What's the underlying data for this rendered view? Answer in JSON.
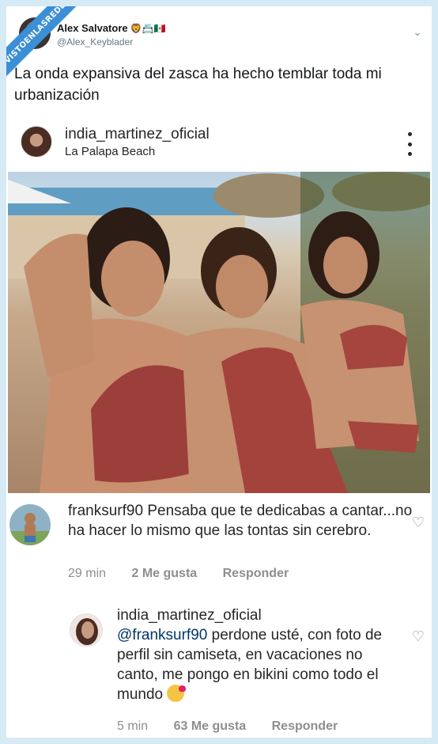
{
  "watermark": "VISTOENLASREDES",
  "tweet": {
    "name": "Alex Salvatore",
    "emojis": "🦁📇🇲🇽",
    "handle": "@Alex_Keyblader",
    "text": "La onda expansiva del zasca ha hecho temblar toda mi urbanización"
  },
  "instagram": {
    "username": "india_martinez_oficial",
    "location": "La Palapa Beach",
    "comments": [
      {
        "user": "franksurf90",
        "text": " Pensaba que te dedicabas a cantar...no ha hacer lo mismo que las tontas sin cerebro.",
        "time": "29 min",
        "likes": "2 Me gusta",
        "reply": "Responder"
      },
      {
        "user": "india_martinez_oficial",
        "mention": "@franksurf90",
        "text": " perdone usté, con foto de perfil sin camiseta, en vacaciones no canto, me pongo en bikini como todo el mundo",
        "time": "5 min",
        "likes": "63 Me gusta",
        "reply": "Responder"
      }
    ]
  },
  "colors": {
    "twitter_bg": "#d6eaf5",
    "watermark": "#3a8fd6",
    "mention": "#00376b",
    "meta": "#8e8e8e"
  }
}
